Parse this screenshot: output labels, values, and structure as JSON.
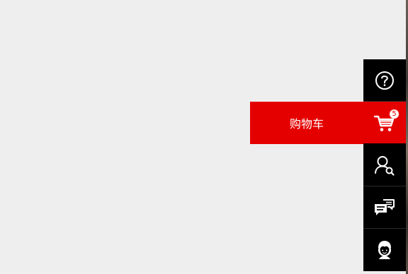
{
  "toolbar": {
    "items": [
      {
        "name": "help",
        "icon": "question-circle-icon"
      },
      {
        "name": "cart",
        "icon": "shopping-cart-icon",
        "label": "购物车",
        "badge": "5"
      },
      {
        "name": "user-search",
        "icon": "user-search-icon"
      },
      {
        "name": "messages",
        "icon": "chat-bubbles-icon"
      },
      {
        "name": "customer-service",
        "icon": "service-agent-icon"
      }
    ]
  },
  "colors": {
    "background": "#eeeeee",
    "toolbar": "#000000",
    "accent": "#e50000",
    "icon": "#ffffff"
  }
}
